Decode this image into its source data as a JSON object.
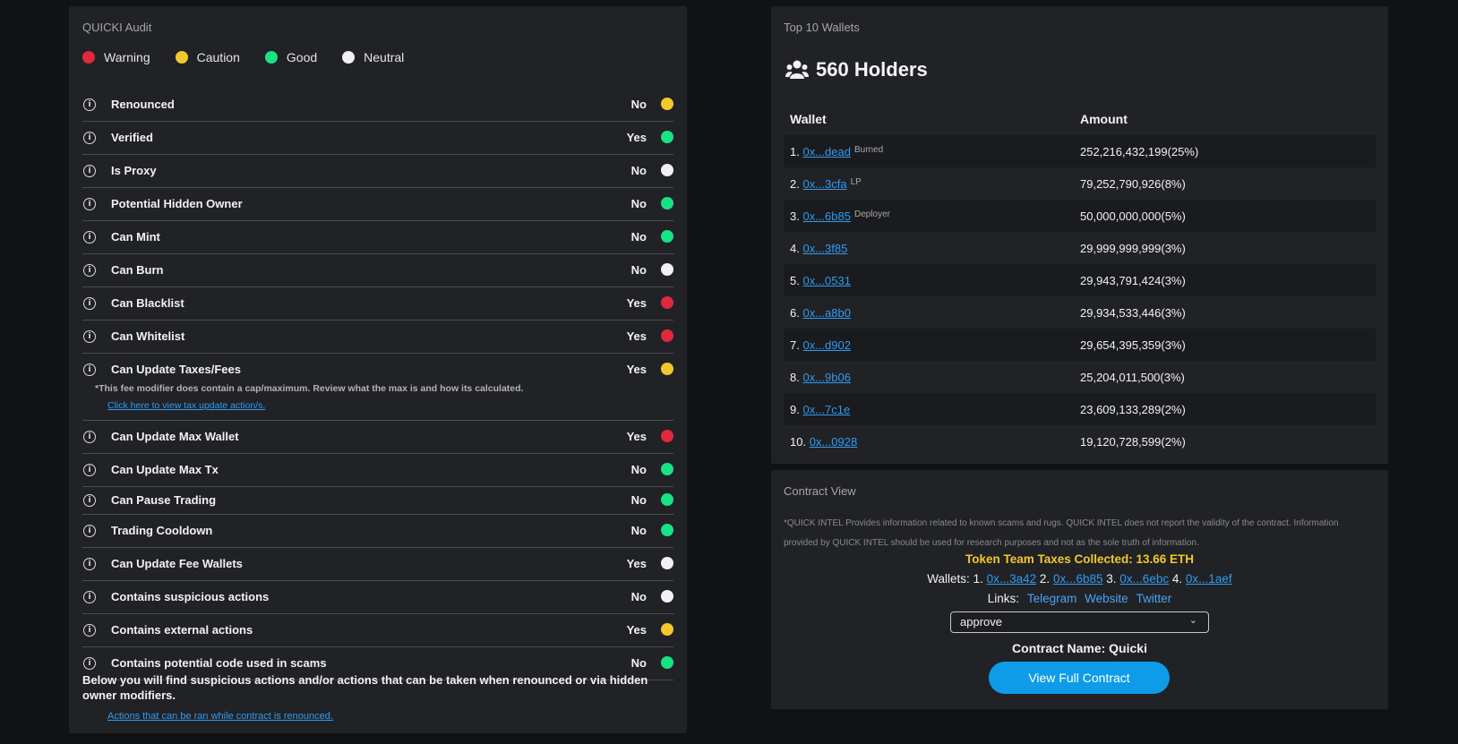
{
  "audit": {
    "title": "QUICKI Audit",
    "legend": [
      {
        "label": "Warning",
        "color": "red"
      },
      {
        "label": "Caution",
        "color": "yellow"
      },
      {
        "label": "Good",
        "color": "green"
      },
      {
        "label": "Neutral",
        "color": "white"
      }
    ],
    "rows": [
      {
        "label": "Renounced",
        "value": "No",
        "status": "yellow"
      },
      {
        "label": "Verified",
        "value": "Yes",
        "status": "green"
      },
      {
        "label": "Is Proxy",
        "value": "No",
        "status": "white"
      },
      {
        "label": "Potential Hidden Owner",
        "value": "No",
        "status": "green"
      },
      {
        "label": "Can Mint",
        "value": "No",
        "status": "green"
      },
      {
        "label": "Can Burn",
        "value": "No",
        "status": "white"
      },
      {
        "label": "Can Blacklist",
        "value": "Yes",
        "status": "red"
      },
      {
        "label": "Can Whitelist",
        "value": "Yes",
        "status": "red"
      },
      {
        "label": "Can Update Taxes/Fees",
        "value": "Yes",
        "status": "yellow"
      },
      {
        "label": "Can Update Max Wallet",
        "value": "Yes",
        "status": "red"
      },
      {
        "label": "Can Update Max Tx",
        "value": "No",
        "status": "green"
      },
      {
        "label": "Can Pause Trading",
        "value": "No",
        "status": "green"
      },
      {
        "label": "Trading Cooldown",
        "value": "No",
        "status": "green"
      },
      {
        "label": "Can Update Fee Wallets",
        "value": "Yes",
        "status": "white"
      },
      {
        "label": "Contains suspicious actions",
        "value": "No",
        "status": "white"
      },
      {
        "label": "Contains external actions",
        "value": "Yes",
        "status": "yellow"
      },
      {
        "label": "Contains potential code used in scams",
        "value": "No",
        "status": "green"
      }
    ],
    "fee_note": "*This fee modifier does contain a cap/maximum. Review what the max is and how its calculated.",
    "fee_link": "Click here to view tax update action/s.",
    "below_text": "Below you will find suspicious actions and/or actions that can be taken when renounced or via hidden owner modifiers.",
    "below_link": "Actions that can be ran while contract is renounced."
  },
  "wallets": {
    "title": "Top 10 Wallets",
    "holders": "560 Holders",
    "icon": "users-icon",
    "columns": [
      "Wallet",
      "Amount"
    ],
    "rows": [
      {
        "rank": "1.",
        "address": "0x...dead",
        "tag": "Burned",
        "amount": "252,216,432,199(25%)"
      },
      {
        "rank": "2.",
        "address": "0x...3cfa",
        "tag": "LP",
        "amount": "79,252,790,926(8%)"
      },
      {
        "rank": "3.",
        "address": "0x...6b85",
        "tag": "Deployer",
        "amount": "50,000,000,000(5%)"
      },
      {
        "rank": "4.",
        "address": "0x...3f85",
        "tag": "",
        "amount": "29,999,999,999(3%)"
      },
      {
        "rank": "5.",
        "address": "0x...0531",
        "tag": "",
        "amount": "29,943,791,424(3%)"
      },
      {
        "rank": "6.",
        "address": "0x...a8b0",
        "tag": "",
        "amount": "29,934,533,446(3%)"
      },
      {
        "rank": "7.",
        "address": "0x...d902",
        "tag": "",
        "amount": "29,654,395,359(3%)"
      },
      {
        "rank": "8.",
        "address": "0x...9b06",
        "tag": "",
        "amount": "25,204,011,500(3%)"
      },
      {
        "rank": "9.",
        "address": "0x...7c1e",
        "tag": "",
        "amount": "23,609,133,289(2%)"
      },
      {
        "rank": "10.",
        "address": "0x...0928",
        "tag": "",
        "amount": "19,120,728,599(2%)"
      }
    ]
  },
  "contract": {
    "title": "Contract View",
    "disclaimer": "*QUICK INTEL Provides information related to known scams and rugs. QUICK INTEL does not report the validity of the contract. Information provided by QUICK INTEL should be used for research purposes and not as the sole truth of information.",
    "taxes": "Token Team Taxes Collected: 13.66 ETH",
    "wallets_label": "Wallets:",
    "wallets": [
      {
        "rank": "1.",
        "address": "0x...3a42"
      },
      {
        "rank": "2.",
        "address": "0x...6b85"
      },
      {
        "rank": "3.",
        "address": "0x...6ebc"
      },
      {
        "rank": "4.",
        "address": "0x...1aef"
      }
    ],
    "links_label": "Links:",
    "links": [
      "Telegram",
      "Website",
      "Twitter"
    ],
    "select_value": "approve",
    "name_label": "Contract Name:",
    "name_value": "Quicki",
    "view_button": "View Full Contract"
  },
  "colors": {
    "red": "#e0293e",
    "yellow": "#f2c82c",
    "green": "#17e384",
    "white": "#f1f1f1",
    "link": "#2f9bf0",
    "button": "#0e9ce8"
  }
}
